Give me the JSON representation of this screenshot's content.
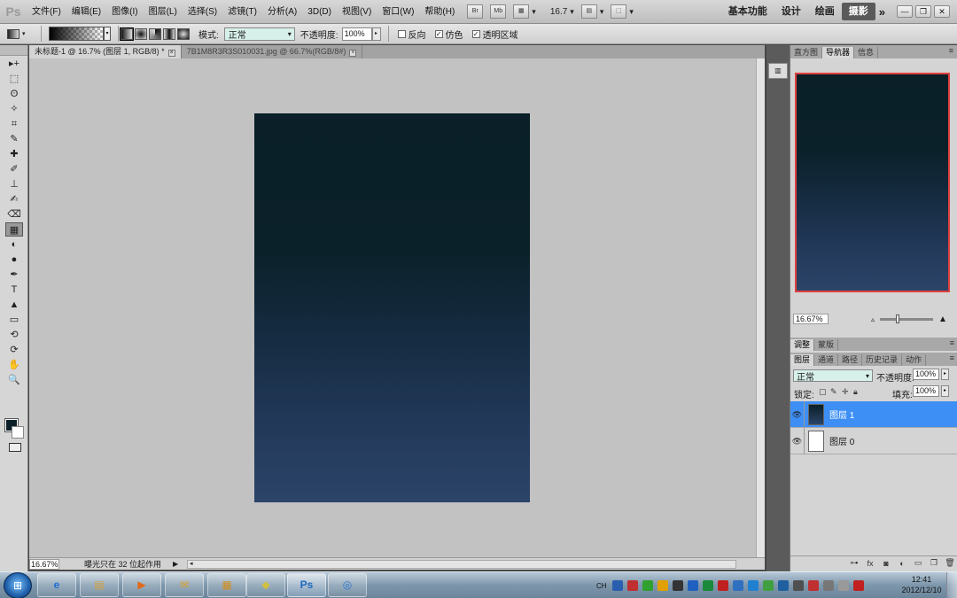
{
  "app": {
    "logo": "Ps"
  },
  "menu": [
    "文件(F)",
    "编辑(E)",
    "图像(I)",
    "图层(L)",
    "选择(S)",
    "滤镜(T)",
    "分析(A)",
    "3D(D)",
    "视图(V)",
    "窗口(W)",
    "帮助(H)"
  ],
  "menubar_buttons": {
    "bridge": "Br",
    "mini_bridge": "Mb",
    "zoom": "16.7"
  },
  "workspaces": {
    "items": [
      "基本功能",
      "设计",
      "绘画",
      "摄影"
    ],
    "active": "摄影",
    "more": "»"
  },
  "window_controls": {
    "minimize": "—",
    "restore": "❐",
    "close": "✕"
  },
  "options": {
    "mode_label": "模式:",
    "mode_value": "正常",
    "opacity_label": "不透明度:",
    "opacity_value": "100%",
    "reverse": {
      "label": "反向",
      "checked": false
    },
    "dither": {
      "label": "仿色",
      "checked": true
    },
    "transparency": {
      "label": "透明区域",
      "checked": true
    }
  },
  "doc_tabs": [
    {
      "label": "未标题-1 @ 16.7% (图层 1, RGB/8) *",
      "active": true
    },
    {
      "label": "7B1M8R3R3S010031.jpg @ 66.7%(RGB/8#)",
      "active": false
    }
  ],
  "tools": [
    "move",
    "marquee",
    "lasso",
    "quick-select",
    "crop",
    "eyedropper",
    "healing",
    "brush",
    "stamp",
    "history-brush",
    "eraser",
    "gradient",
    "blur",
    "dodge",
    "pen",
    "type",
    "path-select",
    "shape",
    "3d-rotate",
    "3d-orbit",
    "hand",
    "zoom"
  ],
  "tool_glyphs": [
    "▸+",
    "⬚",
    "ʘ",
    "✧",
    "⌗",
    "✎",
    "✚",
    "✐",
    "⊥",
    "✍",
    "⌫",
    "▦",
    "◐",
    "●",
    "✒",
    "T",
    "▲",
    "▭",
    "⟲",
    "⟳",
    "✋",
    "🔍"
  ],
  "active_tool": "gradient",
  "colors": {
    "foreground": "#0b2029",
    "background": "#ffffff",
    "canvas_top": "#0a1f27",
    "canvas_bottom": "#2c4468",
    "selection": "#3d8ff5"
  },
  "status": {
    "zoom": "16.67%",
    "info": "曝光只在 32 位起作用",
    "arrow": "▶",
    "scroll_left": "◂"
  },
  "navigator": {
    "tabs": [
      "直方图",
      "导航器",
      "信息"
    ],
    "active": "导航器",
    "zoom": "16.67%"
  },
  "adjust_tabs": [
    "调整",
    "蒙版"
  ],
  "layers_panel": {
    "tabs": [
      "图层",
      "通道",
      "路径",
      "历史记录",
      "动作"
    ],
    "active": "图层",
    "blend_mode": "正常",
    "opacity_label": "不透明度:",
    "opacity_value": "100%",
    "lock_label": "锁定:",
    "fill_label": "填充:",
    "fill_value": "100%",
    "layers": [
      {
        "name": "图层 1",
        "selected": true,
        "thumb": "dark"
      },
      {
        "name": "图层 0",
        "selected": false,
        "thumb": "white"
      }
    ],
    "footer_icons": [
      "link-icon",
      "fx-icon",
      "mask-icon",
      "adjustment-icon",
      "group-icon",
      "new-layer-icon",
      "trash-icon"
    ]
  },
  "taskbar": {
    "apps": [
      "ie",
      "explorer",
      "media-player",
      "outlook",
      "file-manager",
      "notes",
      "photoshop",
      "browser"
    ],
    "active_app": "photoshop",
    "language": "CH",
    "time": "12:41",
    "date": "2012/12/10"
  }
}
